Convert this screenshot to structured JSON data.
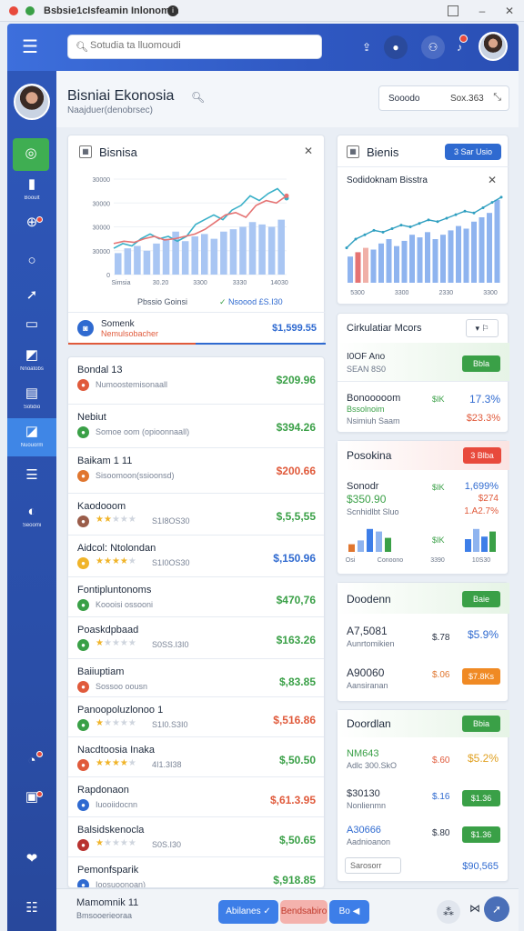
{
  "window": {
    "title": "Bsbsie1cIsfeamin Inlonomin"
  },
  "topbar": {
    "search_placeholder": "Sotudia ta lluomoudi"
  },
  "header": {
    "title": "Bisniai Ekonosia",
    "subtitle": "Naajduer(denobrsec)",
    "search_box": "Sooodo",
    "search_value": "Sox.363"
  },
  "sidebar": {
    "labels": [
      "Booult",
      "Nnoatobs",
      "Sotidio",
      "Nuouorm",
      "Seoomi"
    ]
  },
  "chart_card": {
    "title": "Bisnisa",
    "legend_left": "Pbssio Goinsi",
    "legend_right": "Nsoood £S.I30",
    "footer_name": "Somenk",
    "footer_sub": "Nemulsobacher",
    "footer_amount": "$1,599.55"
  },
  "chart_data": [
    {
      "type": "bar",
      "title": "",
      "ylim": [
        0,
        4000
      ],
      "y_ticks": [
        "0",
        "30000",
        "30000",
        "30000",
        "30000"
      ],
      "x_ticks": [
        "Simsia",
        "30.20",
        "3300",
        "3330",
        "14030"
      ],
      "series": [
        {
          "values": [
            900,
            1100,
            1200,
            1000,
            1300,
            1500,
            1800,
            1400,
            1600,
            1700,
            1500,
            1800,
            1900,
            2000,
            2200,
            2100,
            2000,
            2300
          ]
        },
        {
          "values": [
            1100,
            1300,
            1200,
            1500,
            1700,
            1500,
            1600,
            1400,
            1600,
            2100,
            2300,
            2500,
            2300,
            2700,
            2900,
            3300,
            3100,
            3400,
            3600,
            3200
          ]
        },
        {
          "values": [
            1300,
            1400,
            1350,
            1500,
            1600,
            1450,
            1500,
            1600,
            1700,
            1900,
            2200,
            2500,
            2600,
            2400,
            2900,
            3100,
            3000,
            3300
          ]
        }
      ]
    },
    {
      "type": "bar",
      "title": "Sodidoknam Bisstra",
      "x_ticks": [
        "5300",
        "3300",
        "2330",
        "3300"
      ],
      "series": [
        {
          "values": [
            30,
            35,
            40,
            38,
            45,
            50,
            42,
            48,
            55,
            52,
            58,
            50,
            55,
            60,
            65,
            62,
            70,
            75,
            80,
            95
          ]
        },
        {
          "values": [
            40,
            50,
            55,
            60,
            58,
            62,
            66,
            64,
            68,
            72,
            70,
            74,
            78,
            82,
            80,
            86,
            92,
            98
          ]
        }
      ]
    }
  ],
  "rows": [
    {
      "name": "Bondal 13",
      "sub": "Numoostemisonaall",
      "amount": "$209.96",
      "icon": "#e05a3b",
      "amtcolor": "#3aa047",
      "stars": null
    },
    {
      "name": "Nebiut",
      "sub": "Somoe oom (opioonnaall)",
      "amount": "$394.26",
      "icon": "#3aa047",
      "amtcolor": "#3aa047",
      "stars": null
    },
    {
      "name": "Baikam 1 11",
      "sub": "Sisoomoon(ssioonsd)",
      "amount": "$200.66",
      "icon": "#e0762f",
      "amtcolor": "#e05a3b",
      "stars": null
    },
    {
      "name": "Kaodooom",
      "sub": "S1I8OS30",
      "amount": "$,5,5,55",
      "icon": "#9a5d4a",
      "amtcolor": "#3aa047",
      "stars": 2
    },
    {
      "name": "Aidcol: Ntolondan",
      "sub": "S1I0OS30",
      "amount": "$,150.96",
      "icon": "#f0b429",
      "amtcolor": "#2f6ad0",
      "stars": 4
    },
    {
      "name": "Fontipluntonoms",
      "sub": "Koooisi ossooni",
      "amount": "$470,76",
      "icon": "#3aa047",
      "amtcolor": "#3aa047",
      "stars": null
    },
    {
      "name": "Poaskdpbaad",
      "sub": "S0SS.I3I0",
      "amount": "$163.26",
      "icon": "#3aa047",
      "amtcolor": "#3aa047",
      "stars": 1
    },
    {
      "name": "Baiiuptiam",
      "sub": "Sossoo oousn",
      "amount": "$,83.85",
      "icon": "#e05a3b",
      "amtcolor": "#3aa047",
      "stars": null
    },
    {
      "name": "Panoopoluzlonoo 1",
      "sub": "S1I0.S3I0",
      "amount": "$,516.86",
      "icon": "#3aa047",
      "amtcolor": "#e05a3b",
      "stars": 1
    },
    {
      "name": "Nacdtoosia Inaka",
      "sub": "4I1.3I38",
      "amount": "$,50.50",
      "icon": "#e05a3b",
      "amtcolor": "#3aa047",
      "stars": 4
    },
    {
      "name": "Rapdonaon",
      "sub": "Iuooiidocnn",
      "amount": "$,61.3.95",
      "icon": "#2f6ad0",
      "amtcolor": "#e05a3b",
      "stars": null
    },
    {
      "name": "Balsidskenocla",
      "sub": "S0S.I30",
      "amount": "$,50.65",
      "icon": "#b8322f",
      "amtcolor": "#3aa047",
      "stars": 1
    },
    {
      "name": "Pemonfsparik",
      "sub": "Ioosuoonoan)",
      "amount": "$,918.85",
      "icon": "#2f6ad0",
      "amtcolor": "#3aa047",
      "stars": null
    }
  ],
  "right_chart_card": {
    "title": "Bienis",
    "button": "3 Sar Usio"
  },
  "market": {
    "title": "Cirkulatiar Mcors",
    "first_label": "I0OF Ano",
    "first_sub": "SEAN 8S0",
    "first_btn": "Bbla",
    "row2_name": "Bonooooom",
    "row2_sub": "Bssolnoim",
    "row2_sub2": "Nsimiuh Saam",
    "row2_mid": "$IK",
    "row2_val": "17.3%",
    "row2_val2": "$23.3%"
  },
  "panel_a": {
    "title": "Posokina",
    "badge": "3 Blba",
    "label": "Sonodr",
    "amount": "$350.90",
    "sub": "Scnhidlbt Sluo",
    "mid": "$IK",
    "v1": "1,699%",
    "v2": "$274",
    "v3": "1.A2.7%",
    "xt": [
      "Osi",
      "Conoono",
      "3390",
      "10S30"
    ],
    "bars1": [
      0.3,
      0.45,
      0.9,
      0.8,
      0.55
    ],
    "bars2": [
      0.5,
      0.9,
      0.6,
      0.8
    ]
  },
  "panel_b": {
    "title": "Doodenn",
    "badge": "Baie",
    "r1_name": "A7,5081",
    "r1_sub": "Aunrtomikien",
    "r1_mid": "$.78",
    "r1_val": "$5.9%",
    "r2_name": "A90060",
    "r2_sub": "Aansiranan",
    "r2_mid": "$.06",
    "r2_btn": "$7.8Ks"
  },
  "panel_c": {
    "title": "Doordlan",
    "badge": "Bbia",
    "r1_name": "NM643",
    "r1_sub": "Adlc 300.SkO",
    "r1_mid": "$.60",
    "r1_val": "$5.2%",
    "r2_name": "$30130",
    "r2_sub": "Nonlienmn",
    "r2_mid": "$.16",
    "r2_btn": "$1.36",
    "r3_name": "A30666",
    "r3_sub": "Aadnioanon",
    "r3_mid": "$.80",
    "r3_btn": "$1.36",
    "input": "Sarosorr",
    "total": "$90,565"
  },
  "bottom": {
    "title": "Mamomnik 11",
    "sub": "Bmsooerieoraa",
    "btn1": "Abilanes",
    "btn2": "Bendsabiro",
    "btn3": "Bo"
  }
}
